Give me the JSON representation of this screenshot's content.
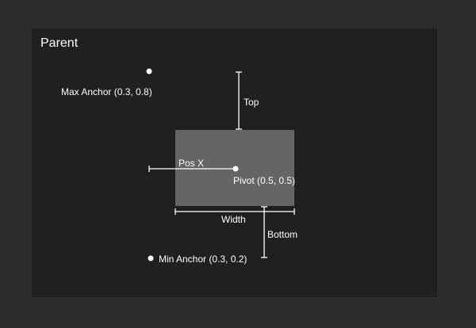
{
  "parent": {
    "title": "Parent"
  },
  "labels": {
    "max_anchor": "Max Anchor (0.3, 0.8)",
    "min_anchor": "Min Anchor (0.3, 0.2)",
    "top": "Top",
    "bottom": "Bottom",
    "pos_x": "Pos X",
    "pivot": "Pivot (0.5, 0.5)",
    "width": "Width"
  },
  "colors": {
    "background": "#2c2b2d",
    "parent_panel": "#201f21",
    "child_rect": "#666566",
    "line": "#ffffff",
    "text": "#ffffff"
  }
}
